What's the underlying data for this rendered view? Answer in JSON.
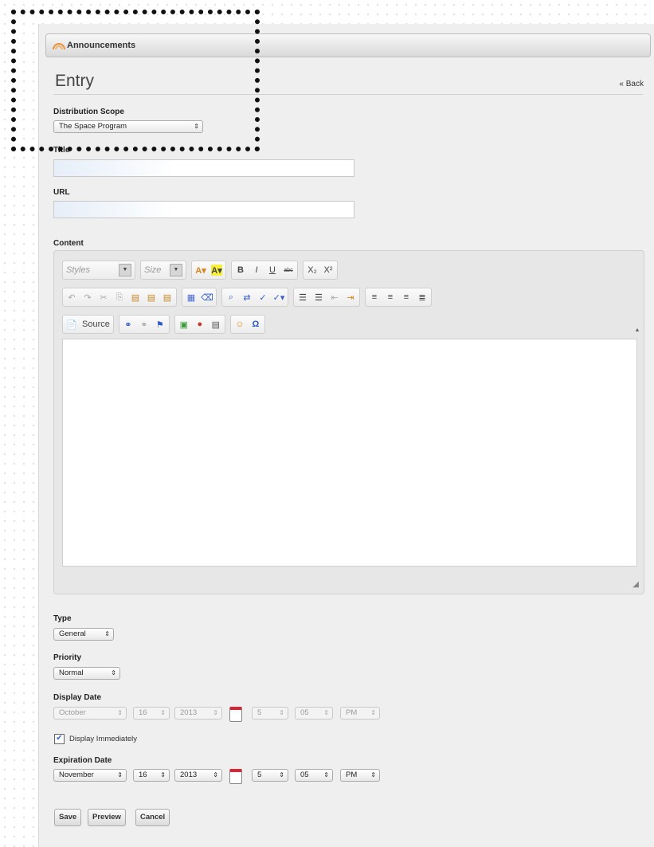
{
  "header": {
    "title": "Announcements"
  },
  "page": {
    "title": "Entry",
    "back_link": "« Back"
  },
  "labels": {
    "scope": "Distribution Scope",
    "title": "Title",
    "url": "URL",
    "content": "Content",
    "type": "Type",
    "priority": "Priority",
    "display_date": "Display Date",
    "display_immediately": "Display Immediately",
    "expiration_date": "Expiration Date"
  },
  "fields": {
    "scope_value": "The Space Program",
    "title_value": "",
    "url_value": "",
    "type_value": "General",
    "priority_value": "Normal",
    "display_date": {
      "month": "October",
      "day": "16",
      "year": "2013",
      "hour": "5",
      "minute": "05",
      "ampm": "PM",
      "disabled": true
    },
    "display_immediately_checked": true,
    "expiration_date": {
      "month": "November",
      "day": "16",
      "year": "2013",
      "hour": "5",
      "minute": "05",
      "ampm": "PM"
    }
  },
  "editor": {
    "styles_placeholder": "Styles",
    "size_placeholder": "Size",
    "bold": "B",
    "italic": "I",
    "underline": "U",
    "strike": "abc",
    "subscript": "X₂",
    "superscript": "X²",
    "source_label": "Source"
  },
  "buttons": {
    "save": "Save",
    "preview": "Preview",
    "cancel": "Cancel"
  },
  "colors": {
    "panel_bg": "#efeff0",
    "accent": "#e07b2c",
    "calendar": "#d22b2b"
  }
}
